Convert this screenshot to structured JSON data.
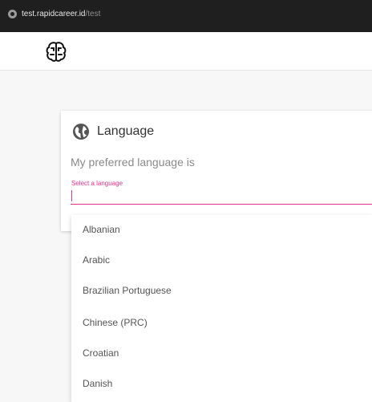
{
  "browser": {
    "url_host": "test.rapidcareer.id",
    "url_path": "/test"
  },
  "header": {
    "logo_icon": "brain-icon"
  },
  "language_card": {
    "icon": "globe-icon",
    "title": "Language",
    "description": "My preferred language is",
    "select": {
      "label": "Select a language",
      "value": "",
      "accent_color": "#e8318c"
    }
  },
  "dropdown": {
    "options": [
      "Albanian",
      "Arabic",
      "Brazilian Portuguese",
      "Chinese (PRC)",
      "Croatian",
      "Danish"
    ]
  }
}
